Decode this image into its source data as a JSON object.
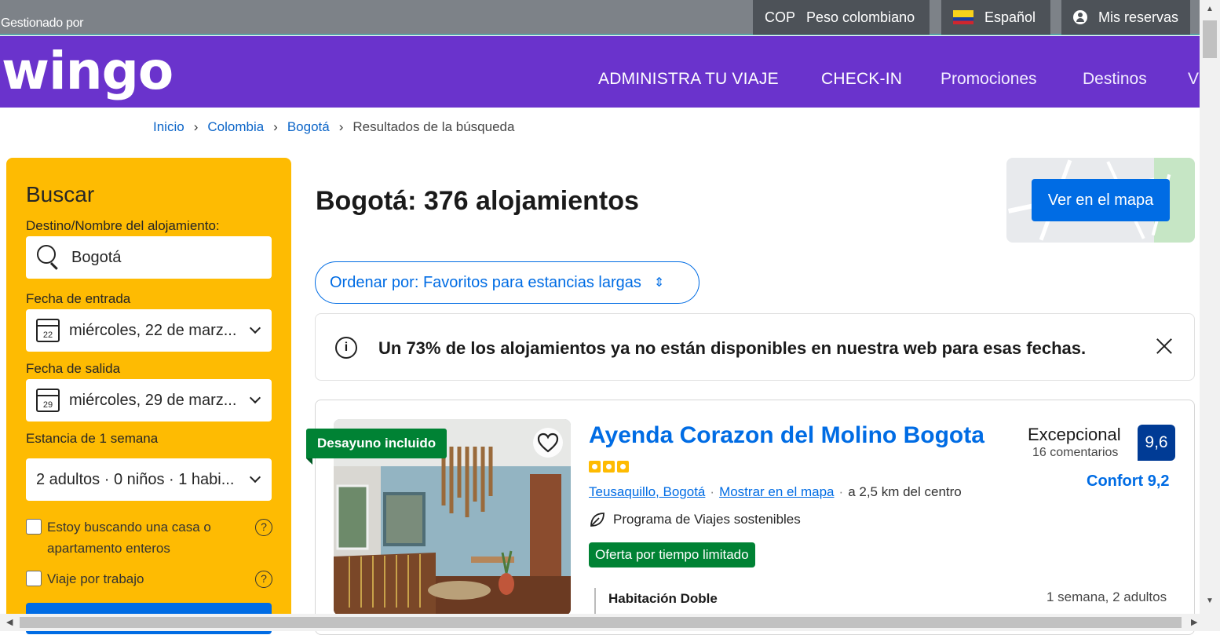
{
  "topbar": {
    "managed_by": "Gestionado por",
    "currency_code": "COP",
    "currency_name": "Peso colombiano",
    "language": "Español",
    "bookings": "Mis reservas"
  },
  "header": {
    "logo": "wingo",
    "nav": [
      "ADMINISTRA TU VIAJE",
      "CHECK-IN",
      "Promociones",
      "Destinos",
      "V"
    ]
  },
  "breadcrumb": [
    "Inicio",
    "Colombia",
    "Bogotá",
    "Resultados de la búsqueda"
  ],
  "search": {
    "title": "Buscar",
    "destination_label": "Destino/Nombre del alojamiento:",
    "destination_value": "Bogotá",
    "checkin_label": "Fecha de entrada",
    "checkin_day": "22",
    "checkin_value": "miércoles, 22 de marz...",
    "checkout_label": "Fecha de salida",
    "checkout_day": "29",
    "checkout_value": "miércoles, 29 de marz...",
    "stay_label": "Estancia de 1 semana",
    "guests_value": "2 adultos · 0 niños · 1 habi...",
    "checkbox_home": "Estoy buscando una casa o apartamento enteros",
    "checkbox_work": "Viaje por trabajo"
  },
  "results": {
    "title": "Bogotá: 376 alojamientos",
    "map_button": "Ver en el mapa",
    "sort_label": "Ordenar por: Favoritos para estancias largas",
    "alert": "Un 73% de los alojamientos ya no están disponibles en nuestra web para esas fechas."
  },
  "hotel": {
    "badge": "Desayuno incluido",
    "name": "Ayenda Corazon del Molino Bogota",
    "stars": 3,
    "area": "Teusaquillo, Bogotá",
    "show_map": "Mostrar en el mapa",
    "distance": "a 2,5 km del centro",
    "sustainability": "Programa de Viajes sostenibles",
    "offer": "Oferta por tiempo limitado",
    "room": "Habitación Doble",
    "stay": "1 semana, 2 adultos",
    "score_word": "Excepcional",
    "reviews": "16 comentarios",
    "score": "9,6",
    "comfort": "Confort 9,2"
  },
  "colors": {
    "brand_purple": "#6a33cc",
    "booking_blue": "#006ce4",
    "search_yellow": "#febb02",
    "green": "#008234",
    "score_navy": "#003b95"
  }
}
